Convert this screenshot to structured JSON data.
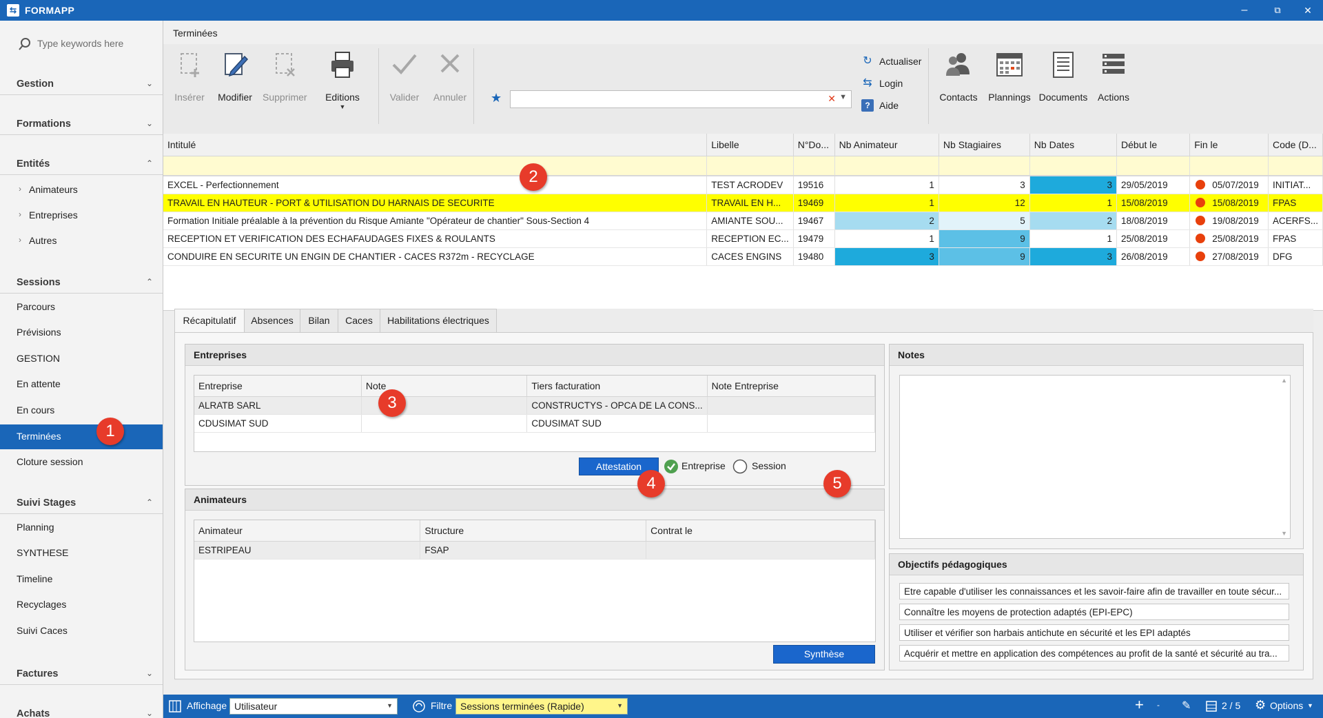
{
  "app": {
    "title": "FORMAPP",
    "logo_glyph": "⇆"
  },
  "window_controls": {
    "minimize": "–",
    "restore": "⧉",
    "close": "✕"
  },
  "sidebar": {
    "search_placeholder": "Type keywords here",
    "groups": [
      {
        "label": "Gestion",
        "expanded": false
      },
      {
        "label": "Formations",
        "expanded": false
      },
      {
        "label": "Entités",
        "expanded": true,
        "items": [
          "Animateurs",
          "Entreprises",
          "Autres"
        ]
      },
      {
        "label": "Sessions",
        "expanded": true,
        "items": [
          "Parcours",
          "Prévisions",
          "GESTION",
          "En attente",
          "En cours",
          "Terminées",
          "Cloture session"
        ],
        "active": "Terminées"
      },
      {
        "label": "Suivi Stages",
        "expanded": true,
        "items": [
          "Planning",
          "SYNTHESE",
          "Timeline",
          "Recyclages",
          "Suivi Caces"
        ]
      },
      {
        "label": "Factures",
        "expanded": false
      },
      {
        "label": "Achats",
        "expanded": false
      }
    ]
  },
  "tab_title": "Terminées",
  "ribbon": {
    "buttons": [
      {
        "label": "Insérer",
        "icon": "insert-icon",
        "disabled": true
      },
      {
        "label": "Modifier",
        "icon": "edit-icon",
        "disabled": false
      },
      {
        "label": "Supprimer",
        "icon": "delete-icon",
        "disabled": true
      },
      {
        "label": "Editions",
        "icon": "printer-icon",
        "disabled": false
      },
      {
        "label": "Valider",
        "icon": "check-icon",
        "disabled": true
      },
      {
        "label": "Annuler",
        "icon": "cancel-icon",
        "disabled": true
      }
    ],
    "small": [
      {
        "label": "Actualiser",
        "icon": "refresh-icon"
      },
      {
        "label": "Login",
        "icon": "login-icon"
      },
      {
        "label": "Aide",
        "icon": "help-icon"
      }
    ],
    "right_buttons": [
      {
        "label": "Contacts",
        "icon": "contacts-icon"
      },
      {
        "label": "Plannings",
        "icon": "calendar-icon"
      },
      {
        "label": "Documents",
        "icon": "document-icon"
      },
      {
        "label": "Actions",
        "icon": "actions-icon"
      }
    ],
    "favorite_value": ""
  },
  "grid": {
    "columns": [
      "Intitulé",
      "Libelle",
      "N°Do...",
      "Nb Animateur",
      "Nb Stagiaires",
      "Nb Dates",
      "Début le",
      "Fin le",
      "Code (D..."
    ],
    "rows": [
      {
        "intitule": "EXCEL - Perfectionnement",
        "libelle": "TEST ACRODEV",
        "ndo": "19516",
        "nb_anim": "1",
        "nb_stag": "3",
        "nb_dates": "3",
        "debut": "29/05/2019",
        "fin": "05/07/2019",
        "code": "INITIAT..."
      },
      {
        "intitule": "TRAVAIL EN HAUTEUR - PORT & UTILISATION DU HARNAIS DE SECURITE",
        "libelle": "TRAVAIL EN H...",
        "ndo": "19469",
        "nb_anim": "1",
        "nb_stag": "12",
        "nb_dates": "1",
        "debut": "15/08/2019",
        "fin": "15/08/2019",
        "code": "FPAS"
      },
      {
        "intitule": "Formation Initiale préalable à la prévention du Risque Amiante \"Opérateur de chantier\" Sous-Section 4",
        "libelle": "AMIANTE SOU...",
        "ndo": "19467",
        "nb_anim": "2",
        "nb_stag": "5",
        "nb_dates": "2",
        "debut": "18/08/2019",
        "fin": "19/08/2019",
        "code": "ACERFS..."
      },
      {
        "intitule": "RECEPTION ET VERIFICATION DES ECHAFAUDAGES FIXES & ROULANTS",
        "libelle": "RECEPTION EC...",
        "ndo": "19479",
        "nb_anim": "1",
        "nb_stag": "9",
        "nb_dates": "1",
        "debut": "25/08/2019",
        "fin": "25/08/2019",
        "code": "FPAS"
      },
      {
        "intitule": "CONDUIRE EN SECURITE UN ENGIN DE CHANTIER - CACES R372m - RECYCLAGE",
        "libelle": "CACES ENGINS",
        "ndo": "19480",
        "nb_anim": "3",
        "nb_stag": "9",
        "nb_dates": "3",
        "debut": "26/08/2019",
        "fin": "27/08/2019",
        "code": "DFG"
      }
    ],
    "selected_index": 1
  },
  "detail": {
    "tabs": [
      "Récapitulatif",
      "Absences",
      "Bilan",
      "Caces",
      "Habilitations électriques"
    ],
    "active_tab": "Récapitulatif",
    "entreprises": {
      "title": "Entreprises",
      "columns": [
        "Entreprise",
        "Note",
        "Tiers facturation",
        "Note Entreprise"
      ],
      "rows": [
        {
          "entreprise": "ALRATB SARL",
          "note": "",
          "tiers": "CONSTRUCTYS - OPCA DE LA CONS...",
          "note_ent": ""
        },
        {
          "entreprise": "CDUSIMAT SUD",
          "note": "",
          "tiers": "CDUSIMAT SUD",
          "note_ent": ""
        }
      ],
      "attestation_label": "Attestation",
      "radio_entreprise": "Entreprise",
      "radio_session": "Session",
      "selected_radio": "Entreprise"
    },
    "animateurs": {
      "title": "Animateurs",
      "columns": [
        "Animateur",
        "Structure",
        "Contrat le"
      ],
      "rows": [
        {
          "animateur": "ESTRIPEAU",
          "structure": "FSAP",
          "contrat": ""
        }
      ],
      "synthese_label": "Synthèse"
    },
    "notes": {
      "title": "Notes"
    },
    "objectifs": {
      "title": "Objectifs pédagogiques",
      "items": [
        "Etre capable d'utiliser les connaissances et les savoir-faire afin de travailler en toute sécur...",
        "Connaître les moyens de protection adaptés (EPI-EPC)",
        "Utiliser et vérifier son harbais antichute en sécurité et les EPI adaptés",
        "Acquérir et mettre en application des compétences au profit de la santé et sécurité au tra..."
      ]
    }
  },
  "statusbar": {
    "affichage_label": "Affichage",
    "affichage_value": "Utilisateur",
    "filtre_label": "Filtre",
    "filtre_value": "Sessions terminées (Rapide)",
    "page": "2 / 5",
    "options_label": "Options"
  },
  "callouts": [
    "1",
    "2",
    "3",
    "4",
    "5"
  ],
  "colors": {
    "accent": "#1a66b8",
    "selected_row": "#ffff00",
    "cell_blue": "#1eaadc",
    "cell_light_blue": "#a6dcf0",
    "status_dot": "#e8400c",
    "badge": "#e73b2a"
  }
}
